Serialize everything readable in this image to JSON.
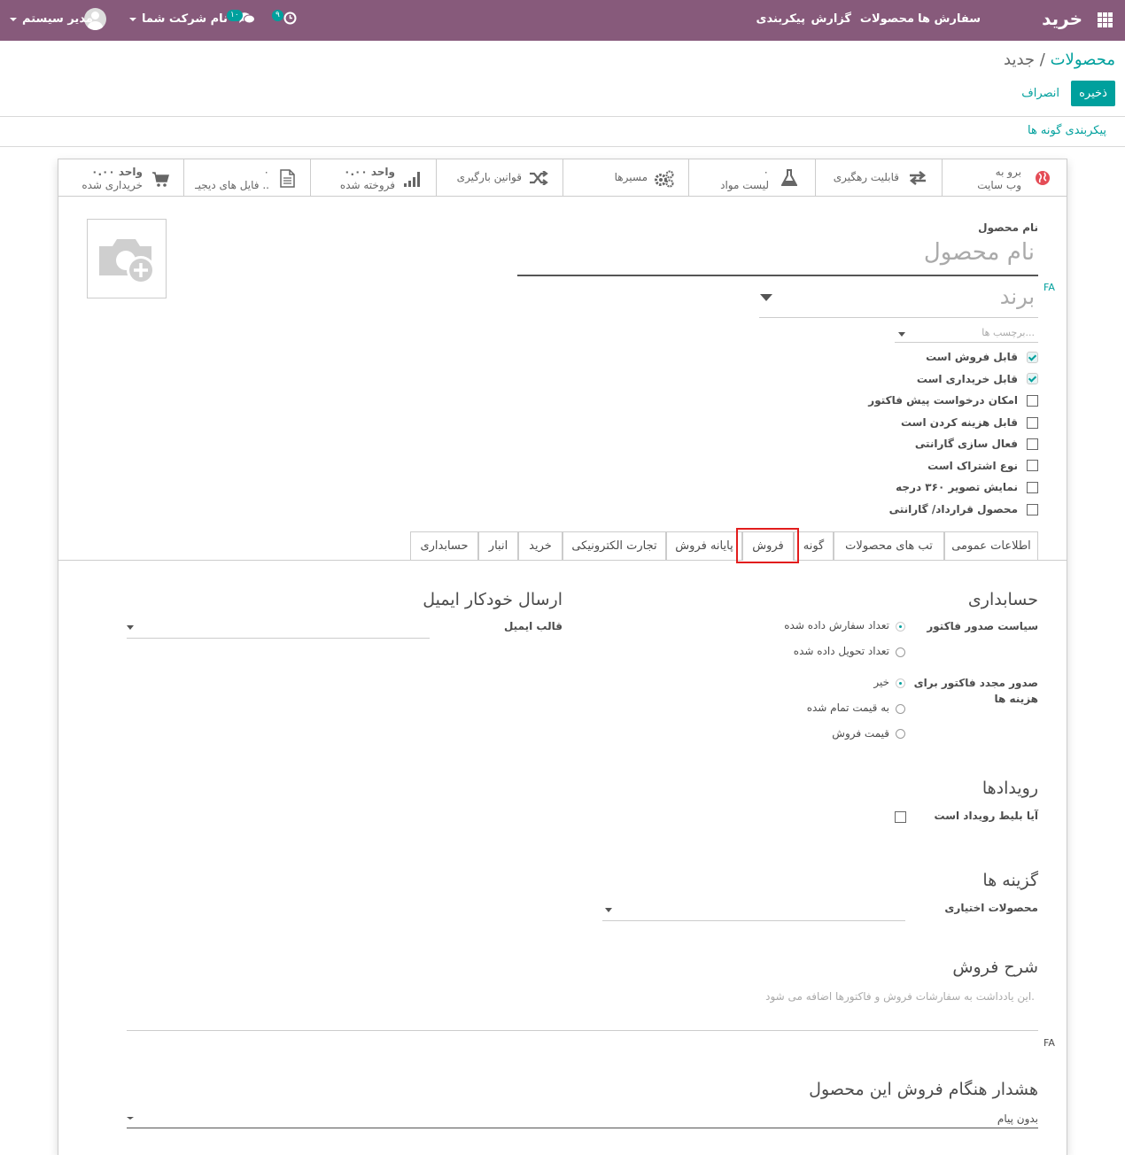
{
  "navbar": {
    "app_name": "خرید",
    "menu": [
      "سفارش ها",
      "محصولات",
      "گزارش",
      "پیکربندی"
    ],
    "activity_count": "۹",
    "messages_count": "۱۰",
    "company": "نام شرکت شما",
    "user": "مدیر سیستم"
  },
  "control_panel": {
    "breadcrumb_parent": "محصولات",
    "breadcrumb_separator": "/",
    "breadcrumb_current": "جدید",
    "save_label": "ذخیره",
    "discard_label": "انصراف",
    "configure_variants_link": "پیکربندی گونه ها"
  },
  "smart_buttons": {
    "website": {
      "line1": "برو به",
      "line2": "وب سایت"
    },
    "traceability": {
      "label": "قابلیت رهگیری"
    },
    "bom": {
      "count": "۰",
      "label": "لیست مواد"
    },
    "routes": {
      "label": "مسیرها"
    },
    "putaway": {
      "label": "قوانین بارگیری"
    },
    "sold": {
      "value": "۰.۰۰ واحد",
      "label": "فروخته شده"
    },
    "documents": {
      "count": "۰",
      "label": "فایل های دیجیـ .."
    },
    "purchased": {
      "value": "۰.۰۰ واحد",
      "label": "خریداری شده"
    }
  },
  "form": {
    "name_label": "نام محصول",
    "name_placeholder": "نام محصول",
    "lang_badge": "FA",
    "brand_placeholder": "برند",
    "tags_placeholder": "برچسب ها...",
    "checkboxes": [
      {
        "label": "قابل فروش است",
        "checked": true
      },
      {
        "label": "قابل خریداری است",
        "checked": true
      },
      {
        "label": "امکان درخواست پیش فاکتور",
        "checked": false
      },
      {
        "label": "قابل هزینه کردن است",
        "checked": false
      },
      {
        "label": "فعال سازی گارانتی",
        "checked": false
      },
      {
        "label": "نوع اشتراک است",
        "checked": false
      },
      {
        "label": "نمایش تصویر ۳۶۰ درجه",
        "checked": false
      },
      {
        "label": "محصول قرارداد/ گارانتی",
        "checked": false
      }
    ]
  },
  "tabs": [
    "اطلاعات عمومی",
    "تب های محصولات",
    "گونه",
    "فروش",
    "پایانه فروش",
    "تجارت الکترونیکی",
    "خرید",
    "انبار",
    "حسابداری"
  ],
  "active_tab": "فروش",
  "sales_tab": {
    "invoicing_title": "حسابداری",
    "invoice_policy_label": "سیاست صدور فاکتور",
    "invoice_policy_options": [
      "تعداد سفارش داده شده",
      "تعداد تحویل داده شده"
    ],
    "invoice_policy_selected": 0,
    "reinvoice_label_1": "صدور مجدد فاکتور برای",
    "reinvoice_label_2": "هزینه ها",
    "reinvoice_options": [
      "خیر",
      "به قیمت تمام شده",
      "قیمت فروش"
    ],
    "reinvoice_selected": 0,
    "email_title": "ارسال خودکار ایمیل",
    "email_template_label": "قالب ایمیل",
    "events_title": "رویدادها",
    "event_ticket_label": "آیا بلیط رویداد است",
    "options_title": "گزینه ها",
    "optional_products_label": "محصولات اختیاری",
    "description_title": "شرح فروش",
    "description_help": "این یادداشت به سفارشات فروش و فاکتورها اضافه می شود.",
    "warning_title": "هشدار هنگام فروش این محصول",
    "warning_value": "بدون پیام"
  }
}
